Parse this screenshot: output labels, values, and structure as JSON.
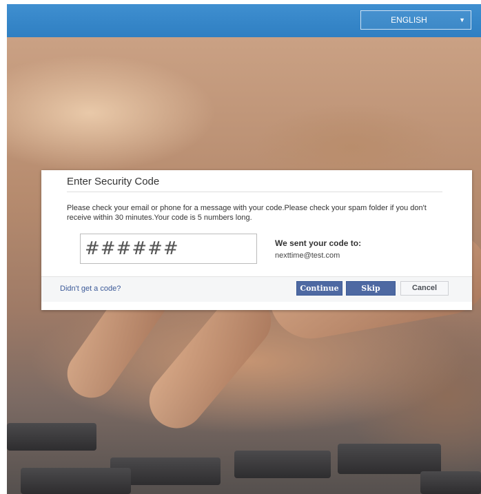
{
  "header": {
    "language_selected": "ENGLISH",
    "language_caret_icon": "chevron-down-icon",
    "bar_color": "#3a8ad0"
  },
  "dialog": {
    "title": "Enter Security Code",
    "message": "Please check your email or phone for a message with your code.Please check your spam folder if you don't receive within 30 minutes.Your code is 5 numbers long.",
    "code_input": {
      "placeholder": "######",
      "value": ""
    },
    "sent_title": "We sent your code to:",
    "sent_to": "nexttime@test.com",
    "footer": {
      "no_code_link": "Didn't get a code?",
      "continue_label": "Continue",
      "skip_label": "Skip",
      "cancel_label": "Cancel"
    }
  },
  "colors": {
    "primary_button": "#4e69a2",
    "link": "#3b5998"
  }
}
